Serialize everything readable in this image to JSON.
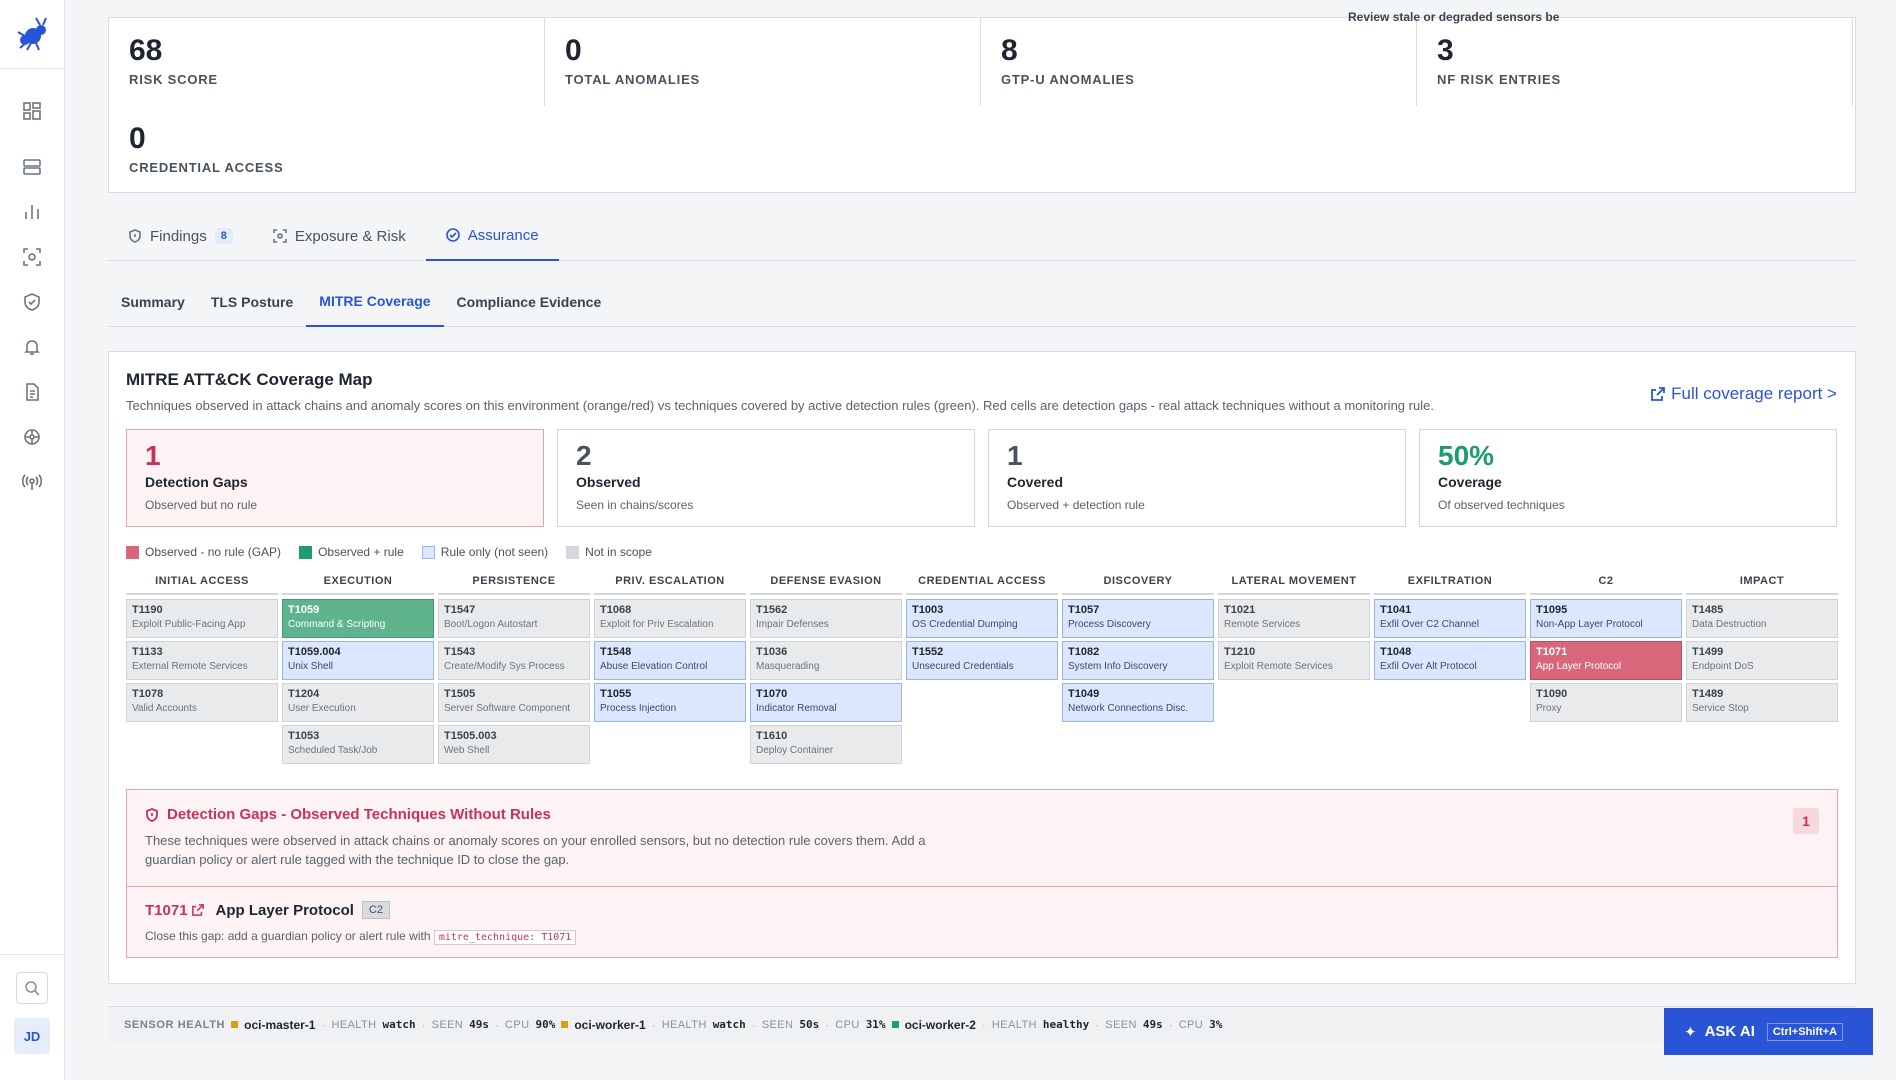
{
  "stats": [
    {
      "value": "68",
      "label": "RISK SCORE"
    },
    {
      "value": "0",
      "label": "TOTAL ANOMALIES"
    },
    {
      "value": "8",
      "label": "GTP-U ANOMALIES"
    },
    {
      "value": "3",
      "label": "NF RISK ENTRIES"
    },
    {
      "value": "0",
      "label": "CREDENTIAL ACCESS"
    }
  ],
  "tabs": [
    {
      "label": "Findings",
      "badge": "8"
    },
    {
      "label": "Exposure & Risk"
    },
    {
      "label": "Assurance"
    }
  ],
  "subtabs": [
    "Summary",
    "TLS Posture",
    "MITRE Coverage",
    "Compliance Evidence"
  ],
  "panel": {
    "title": "MITRE ATT&CK Coverage Map",
    "description": "Techniques observed in attack chains and anomaly scores on this environment (orange/red) vs techniques covered by active detection rules (green). Red cells are detection gaps - real attack techniques without a monitoring rule.",
    "full_report": "Full coverage report >"
  },
  "kpis": [
    {
      "value": "1",
      "title": "Detection Gaps",
      "sub": "Observed but no rule"
    },
    {
      "value": "2",
      "title": "Observed",
      "sub": "Seen in chains/scores"
    },
    {
      "value": "1",
      "title": "Covered",
      "sub": "Observed + detection rule"
    },
    {
      "value": "50%",
      "title": "Coverage",
      "sub": "Of observed techniques"
    }
  ],
  "legend": [
    {
      "label": "Observed - no rule (GAP)",
      "color": "#d9677c"
    },
    {
      "label": "Observed + rule",
      "color": "#1f9b6d"
    },
    {
      "label": "Rule only (not seen)",
      "color": "#dce6fd"
    },
    {
      "label": "Not in scope",
      "color": "#d3d6da"
    }
  ],
  "matrix": [
    {
      "tactic": "INITIAL ACCESS",
      "cells": [
        {
          "id": "T1190",
          "name": "Exploit Public-Facing App",
          "status": "none"
        },
        {
          "id": "T1133",
          "name": "External Remote Services",
          "status": "none"
        },
        {
          "id": "T1078",
          "name": "Valid Accounts",
          "status": "none"
        }
      ]
    },
    {
      "tactic": "EXECUTION",
      "cells": [
        {
          "id": "T1059",
          "name": "Command & Scripting",
          "status": "cov"
        },
        {
          "id": "T1059.004",
          "name": "Unix Shell",
          "status": "rule"
        },
        {
          "id": "T1204",
          "name": "User Execution",
          "status": "none"
        },
        {
          "id": "T1053",
          "name": "Scheduled Task/Job",
          "status": "none"
        }
      ]
    },
    {
      "tactic": "PERSISTENCE",
      "cells": [
        {
          "id": "T1547",
          "name": "Boot/Logon Autostart",
          "status": "none"
        },
        {
          "id": "T1543",
          "name": "Create/Modify Sys Process",
          "status": "none"
        },
        {
          "id": "T1505",
          "name": "Server Software Component",
          "status": "none"
        },
        {
          "id": "T1505.003",
          "name": "Web Shell",
          "status": "none"
        }
      ]
    },
    {
      "tactic": "PRIV. ESCALATION",
      "cells": [
        {
          "id": "T1068",
          "name": "Exploit for Priv Escalation",
          "status": "none"
        },
        {
          "id": "T1548",
          "name": "Abuse Elevation Control",
          "status": "rule"
        },
        {
          "id": "T1055",
          "name": "Process Injection",
          "status": "rule"
        }
      ]
    },
    {
      "tactic": "DEFENSE EVASION",
      "cells": [
        {
          "id": "T1562",
          "name": "Impair Defenses",
          "status": "none"
        },
        {
          "id": "T1036",
          "name": "Masquerading",
          "status": "none"
        },
        {
          "id": "T1070",
          "name": "Indicator Removal",
          "status": "rule"
        },
        {
          "id": "T1610",
          "name": "Deploy Container",
          "status": "none"
        }
      ]
    },
    {
      "tactic": "CREDENTIAL ACCESS",
      "cells": [
        {
          "id": "T1003",
          "name": "OS Credential Dumping",
          "status": "rule"
        },
        {
          "id": "T1552",
          "name": "Unsecured Credentials",
          "status": "rule"
        }
      ]
    },
    {
      "tactic": "DISCOVERY",
      "cells": [
        {
          "id": "T1057",
          "name": "Process Discovery",
          "status": "rule"
        },
        {
          "id": "T1082",
          "name": "System Info Discovery",
          "status": "rule"
        },
        {
          "id": "T1049",
          "name": "Network Connections Disc.",
          "status": "rule"
        }
      ]
    },
    {
      "tactic": "LATERAL MOVEMENT",
      "cells": [
        {
          "id": "T1021",
          "name": "Remote Services",
          "status": "none"
        },
        {
          "id": "T1210",
          "name": "Exploit Remote Services",
          "status": "none"
        }
      ]
    },
    {
      "tactic": "EXFILTRATION",
      "cells": [
        {
          "id": "T1041",
          "name": "Exfil Over C2 Channel",
          "status": "rule"
        },
        {
          "id": "T1048",
          "name": "Exfil Over Alt Protocol",
          "status": "rule"
        }
      ]
    },
    {
      "tactic": "C2",
      "cells": [
        {
          "id": "T1095",
          "name": "Non-App Layer Protocol",
          "status": "rule"
        },
        {
          "id": "T1071",
          "name": "App Layer Protocol",
          "status": "gap"
        },
        {
          "id": "T1090",
          "name": "Proxy",
          "status": "none"
        }
      ]
    },
    {
      "tactic": "IMPACT",
      "cells": [
        {
          "id": "T1485",
          "name": "Data Destruction",
          "status": "none"
        },
        {
          "id": "T1499",
          "name": "Endpoint DoS",
          "status": "none"
        },
        {
          "id": "T1489",
          "name": "Service Stop",
          "status": "none"
        }
      ]
    }
  ],
  "gaps": {
    "title": "Detection Gaps - Observed Techniques Without Rules",
    "description": "These techniques were observed in attack chains or anomaly scores on your enrolled sensors, but no detection rule covers them. Add a guardian policy or alert rule tagged with the technique ID to close the gap.",
    "count": "1",
    "item": {
      "id": "T1071",
      "name": "App Layer Protocol",
      "tag": "C2",
      "hint": "Close this gap: add a guardian policy or alert rule with",
      "code": "mitre_technique: T1071"
    }
  },
  "footer": {
    "label": "SENSOR HEALTH",
    "sensors": [
      {
        "name": "oci-master-1",
        "health": "watch",
        "seen": "49s",
        "cpu": "90%",
        "color": "#d4a017"
      },
      {
        "name": "oci-worker-1",
        "health": "watch",
        "seen": "50s",
        "cpu": "31%",
        "color": "#d4a017"
      },
      {
        "name": "oci-worker-2",
        "health": "healthy",
        "seen": "49s",
        "cpu": "3%",
        "color": "#1f9b6d"
      }
    ],
    "k_health": "HEALTH",
    "k_seen": "SEEN",
    "k_cpu": "CPU",
    "right": "Review stale or degraded sensors be"
  },
  "ask": {
    "label": "ASK AI",
    "shortcut": "Ctrl+Shift+A"
  },
  "avatar": "JD"
}
